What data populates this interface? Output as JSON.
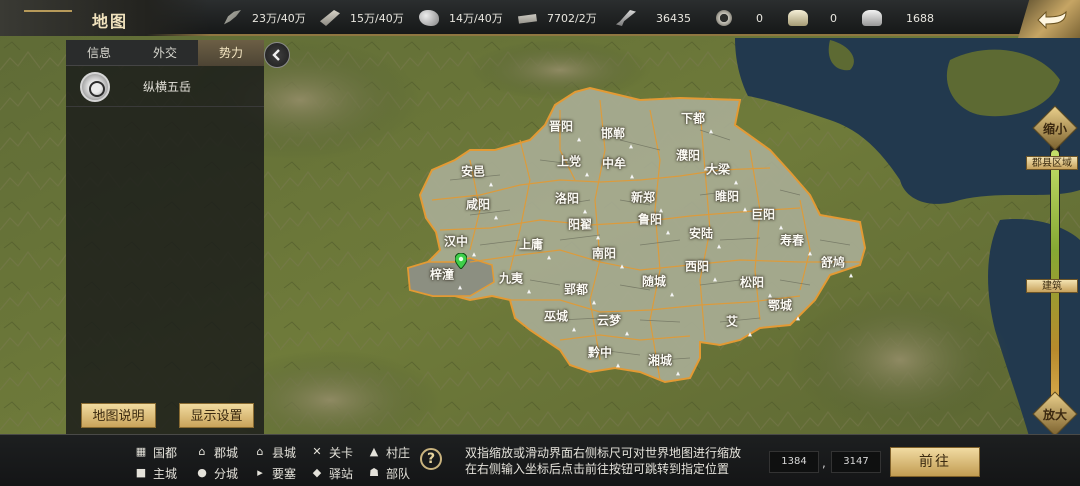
{
  "header": {
    "title": "地图",
    "resources": [
      {
        "icon": "grain-icon",
        "value": "23万/40万"
      },
      {
        "icon": "wood-icon",
        "value": "15万/40万"
      },
      {
        "icon": "stone-icon",
        "value": "14万/40万"
      },
      {
        "icon": "iron-icon",
        "value": "7702/2万"
      },
      {
        "icon": "troops-icon",
        "value": "36435"
      },
      {
        "icon": "coin-icon",
        "value": "0"
      },
      {
        "icon": "gold-ingot-icon",
        "value": "0"
      },
      {
        "icon": "silver-ingot-icon",
        "value": "1688"
      }
    ]
  },
  "left_panel": {
    "tabs": [
      "信息",
      "外交",
      "势力"
    ],
    "active_tab": "势力",
    "faction_name": "纵横五岳",
    "map_info_button": "地图说明",
    "display_settings_button": "显示设置"
  },
  "zoom": {
    "shrink_label": "缩小",
    "enlarge_label": "放大",
    "county_tag": "郡县区域",
    "building_tag": "建筑"
  },
  "map": {
    "cities": [
      "晋阳",
      "邯郸",
      "下都",
      "安邑",
      "上党",
      "中牟",
      "濮阳",
      "大梁",
      "咸阳",
      "洛阳",
      "新郑",
      "睢阳",
      "巨阳",
      "阳翟",
      "鲁阳",
      "汉中",
      "上庸",
      "南阳",
      "安陆",
      "寿春",
      "舒鸠",
      "梓潼",
      "九夷",
      "西阳",
      "郢都",
      "随城",
      "松阳",
      "巫城",
      "云梦",
      "艾",
      "鄂城",
      "黔中",
      "湘城"
    ]
  },
  "legend": [
    {
      "icon": "capital-icon",
      "label": "国都"
    },
    {
      "icon": "commandery-icon",
      "label": "郡城"
    },
    {
      "icon": "county-icon",
      "label": "县城"
    },
    {
      "icon": "pass-icon",
      "label": "关卡"
    },
    {
      "icon": "village-icon",
      "label": "村庄"
    },
    {
      "icon": "main-city-icon",
      "label": "主城"
    },
    {
      "icon": "branch-city-icon",
      "label": "分城"
    },
    {
      "icon": "fortress-icon",
      "label": "要塞"
    },
    {
      "icon": "relay-station-icon",
      "label": "驿站"
    },
    {
      "icon": "troops-icon",
      "label": "部队"
    }
  ],
  "hint": {
    "line1": "双指缩放或滑动界面右侧标尺可对世界地图进行缩放",
    "line2": "在右侧输入坐标后点击前往按钮可跳转到指定位置"
  },
  "coords": {
    "x": "1384",
    "separator": ",",
    "y": "3147"
  },
  "goto_button": "前往",
  "colors": {
    "accent_gold": "#c9a35a",
    "territory": "#a9ad93",
    "border": "#e6a53c",
    "sea": "#20394f"
  }
}
